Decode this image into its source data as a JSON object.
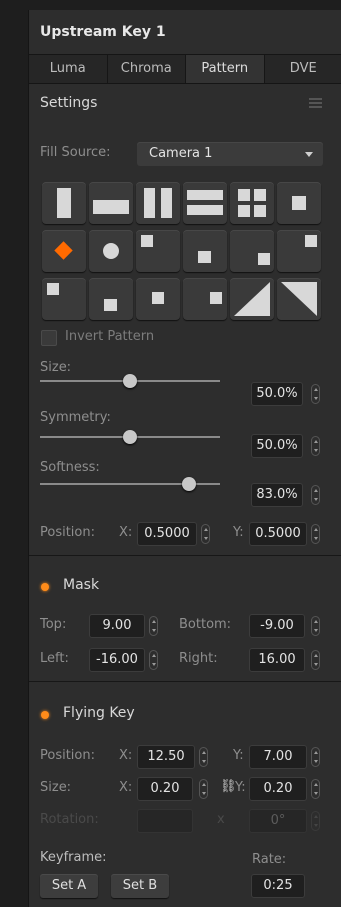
{
  "panel": {
    "title": "Upstream Key 1"
  },
  "tabs": [
    {
      "label": "Luma"
    },
    {
      "label": "Chroma"
    },
    {
      "label": "Pattern"
    },
    {
      "label": "DVE"
    }
  ],
  "settings": {
    "title": "Settings",
    "fill_source_label": "Fill Source:",
    "fill_source_value": "Camera 1",
    "patterns": [
      "vertical-bar-pattern",
      "horizontal-bar-pattern",
      "vertical-barn-door-pattern",
      "horizontal-barn-door-pattern",
      "corner-box-pattern",
      "box-iris-pattern",
      "diamond-iris-pattern",
      "circle-iris-pattern",
      "top-left-box-pattern",
      "top-center-box-pattern",
      "top-right-box-pattern",
      "right-center-box-pattern",
      "bottom-right-box-pattern",
      "bottom-center-box-pattern",
      "bottom-left-box-pattern",
      "left-center-box-pattern",
      "top-left-diagonal-pattern",
      "top-right-diagonal-pattern"
    ],
    "selected_pattern": "diamond-iris-pattern",
    "invert_label": "Invert Pattern",
    "size_label": "Size:",
    "size_value": "50.0%",
    "size_fraction": 0.5,
    "symmetry_label": "Symmetry:",
    "symmetry_value": "50.0%",
    "symmetry_fraction": 0.5,
    "softness_label": "Softness:",
    "softness_value": "83.0%",
    "softness_fraction": 0.83,
    "position_label": "Position:",
    "x_label": "X:",
    "x_value": "0.5000",
    "y_label": "Y:",
    "y_value": "0.5000"
  },
  "mask": {
    "title": "Mask",
    "top_label": "Top:",
    "top_value": "9.00",
    "bottom_label": "Bottom:",
    "bottom_value": "-9.00",
    "left_label": "Left:",
    "left_value": "-16.00",
    "right_label": "Right:",
    "right_value": "16.00"
  },
  "flying_key": {
    "title": "Flying Key",
    "position_label": "Position:",
    "pos_x_label": "X:",
    "pos_x_value": "12.50",
    "pos_y_label": "Y:",
    "pos_y_value": "7.00",
    "size_label": "Size:",
    "size_x_label": "X:",
    "size_x_value": "0.20",
    "size_y_label": "Y:",
    "size_y_value": "0.20",
    "link_symbol": "⛓",
    "rotation_label": "Rotation:",
    "rotation_x": "x",
    "rotation_value": "0°",
    "keyframe_label": "Keyframe:",
    "set_a": "Set A",
    "set_b": "Set B",
    "rate_label": "Rate:",
    "rate_value": "0:25"
  },
  "colors": {
    "accent": "#ff8c1a",
    "panel": "#2d2d2d",
    "background": "#1e1e1e"
  }
}
